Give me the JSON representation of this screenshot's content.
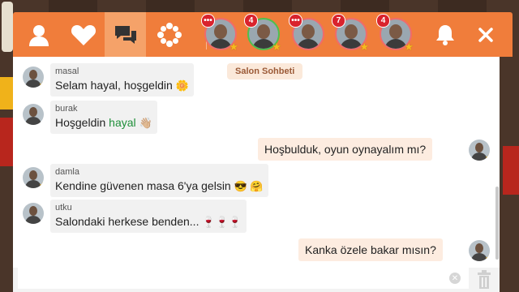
{
  "colors": {
    "topbar": "#f07d3b",
    "active_tab": "#f5a269",
    "badge": "#d9232d",
    "highlight_name": "#1f8f3a",
    "own_bubble": "#fdece0"
  },
  "topbar": {
    "tabs": [
      {
        "icon": "user-icon"
      },
      {
        "icon": "heart-icon"
      },
      {
        "icon": "chat-bubbles-icon",
        "active": true
      },
      {
        "icon": "settings-gear-icon"
      }
    ],
    "online_users": [
      {
        "badge": "•••"
      },
      {
        "badge": "4"
      },
      {
        "badge": "•••"
      },
      {
        "badge": "7"
      },
      {
        "badge": "4"
      }
    ],
    "notification_icon": "bell-icon",
    "close_icon": "close-icon"
  },
  "chat": {
    "room_label": "Salon Sohbeti",
    "messages": [
      {
        "sender": "masal",
        "text": "Selam hayal, hoşgeldin",
        "emoji": "🌼"
      },
      {
        "sender": "burak",
        "text": "Hoşgeldin",
        "mention": "hayal",
        "emoji": "👋🏼"
      },
      {
        "own": true,
        "text": "Hoşbulduk, oyun oynayalım mı?"
      },
      {
        "sender": "damla",
        "text": "Kendine güvenen masa 6'ya gelsin",
        "emoji": "😎 🤗"
      },
      {
        "sender": "utku",
        "text": "Salondaki herkese benden...",
        "emoji": "🍷🍷🍷"
      },
      {
        "own": true,
        "text": "Kanka özele bakar mısın?"
      }
    ]
  },
  "input": {
    "placeholder": "",
    "value": ""
  }
}
